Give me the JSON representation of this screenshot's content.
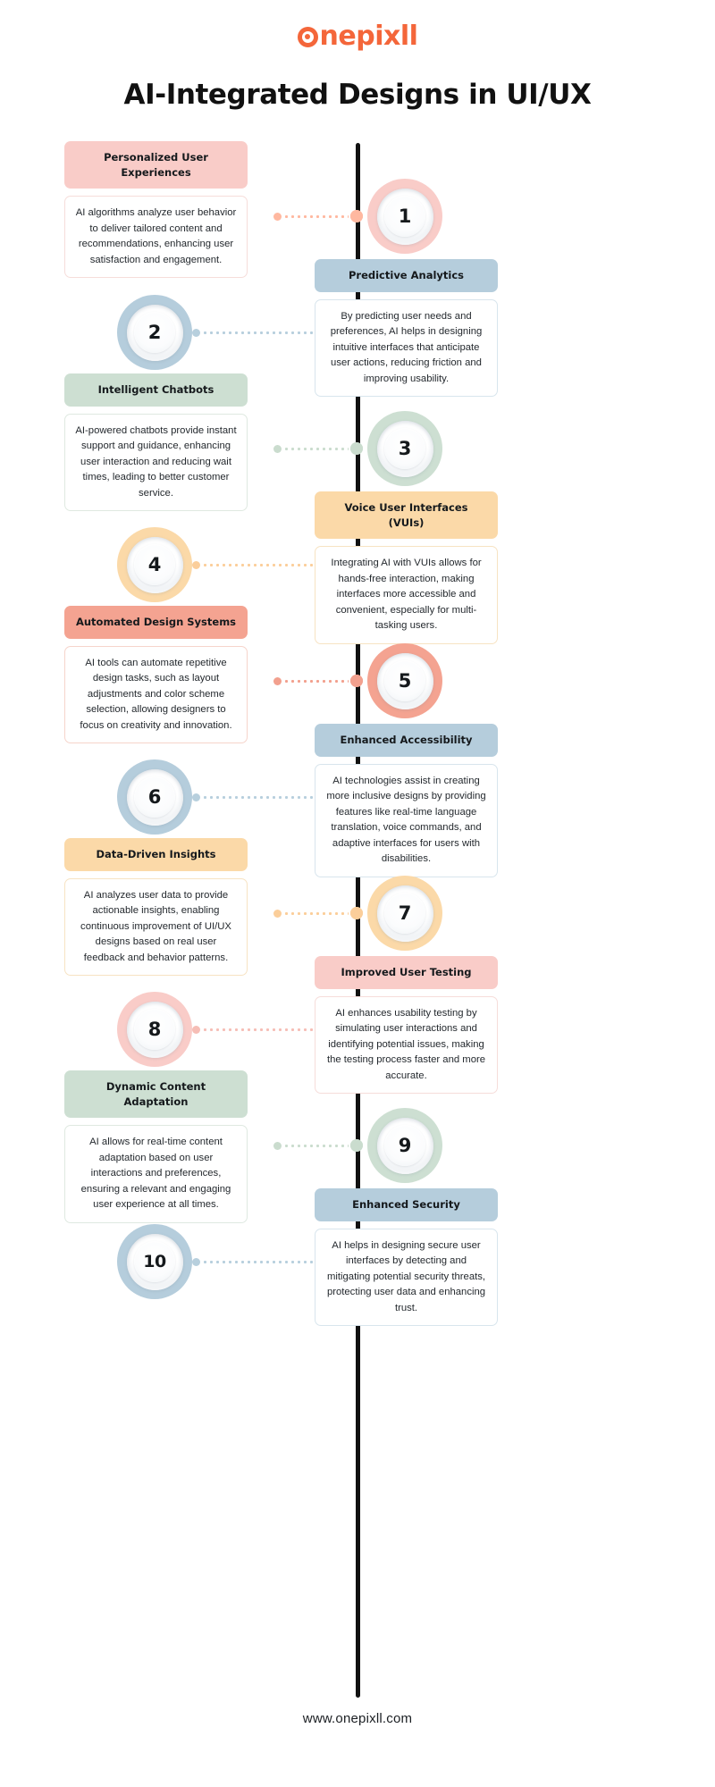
{
  "brand": {
    "logo_text": "onepixll",
    "logo_color": "#f4663a"
  },
  "header": {
    "title": "AI-Integrated Designs in UI/UX"
  },
  "footer": {
    "url": "www.onepixll.com"
  },
  "theme": {
    "spine_color": "#111111",
    "pink": "#f9ccc8",
    "pink_dot": "#ffb8a0",
    "blue": "#b5cddc",
    "green": "#cddfd2",
    "orange": "#fbd9a8",
    "salmon": "#f4a391"
  },
  "items": [
    {
      "number": "1",
      "side_card": "left",
      "title": "Personalized User Experiences",
      "body": "AI algorithms analyze user behavior to deliver tailored content and recommendations, enhancing user satisfaction and engagement.",
      "color": "#f9ccc8",
      "dot_color": "#ffb8a0",
      "border": "#f6ddda"
    },
    {
      "number": "2",
      "side_card": "right",
      "title": "Predictive Analytics",
      "body": "By predicting user needs and preferences, AI helps in designing intuitive interfaces that anticipate user actions, reducing friction and improving usability.",
      "color": "#b5cddc",
      "dot_color": "#b7cfdd",
      "border": "#d8e5ed"
    },
    {
      "number": "3",
      "side_card": "left",
      "title": "Intelligent Chatbots",
      "body": "AI-powered chatbots provide instant support and guidance, enhancing user interaction and reducing wait times, leading to better customer service.",
      "color": "#cddfd2",
      "dot_color": "#cadcce",
      "border": "#dfe9e1"
    },
    {
      "number": "4",
      "side_card": "right",
      "title": "Voice User Interfaces (VUIs)",
      "body": "Integrating AI with VUIs allows for hands-free interaction, making interfaces more accessible and convenient, especially for multi-tasking users.",
      "color": "#fbd9a8",
      "dot_color": "#fbce9a",
      "border": "#f7e3c3"
    },
    {
      "number": "5",
      "side_card": "left",
      "title": "Automated Design Systems",
      "body": "AI tools can automate repetitive design tasks, such as layout adjustments and color scheme selection, allowing designers to focus on creativity and innovation.",
      "color": "#f4a391",
      "dot_color": "#f2a08e",
      "border": "#f6d4cb"
    },
    {
      "number": "6",
      "side_card": "right",
      "title": "Enhanced Accessibility",
      "body": "AI technologies assist in creating more inclusive designs by providing features like real-time language translation, voice commands, and adaptive interfaces for users with disabilities.",
      "color": "#b5cddc",
      "dot_color": "#b7cfdd",
      "border": "#d8e5ed"
    },
    {
      "number": "7",
      "side_card": "left",
      "title": "Data-Driven Insights",
      "body": "AI analyzes user data to provide actionable insights, enabling continuous improvement of UI/UX designs based on real user feedback and behavior patterns.",
      "color": "#fbd9a8",
      "dot_color": "#fbce9a",
      "border": "#f7e3c3"
    },
    {
      "number": "8",
      "side_card": "right",
      "title": "Improved User Testing",
      "body": "AI enhances usability testing by simulating user interactions and identifying potential issues, making the testing process faster and more accurate.",
      "color": "#f9ccc8",
      "dot_color": "#f6bdb5",
      "border": "#f6ddda"
    },
    {
      "number": "9",
      "side_card": "left",
      "title": "Dynamic Content Adaptation",
      "body": "AI allows for real-time content adaptation based on user interactions and preferences, ensuring a relevant and engaging user experience at all times.",
      "color": "#cddfd2",
      "dot_color": "#cadcce",
      "border": "#dfe9e1"
    },
    {
      "number": "10",
      "side_card": "right",
      "title": "Enhanced Security",
      "body": "AI helps in designing secure user interfaces by detecting and mitigating potential security threats, protecting user data and enhancing trust.",
      "color": "#b5cddc",
      "dot_color": "#b7cfdd",
      "border": "#d8e5ed"
    }
  ]
}
